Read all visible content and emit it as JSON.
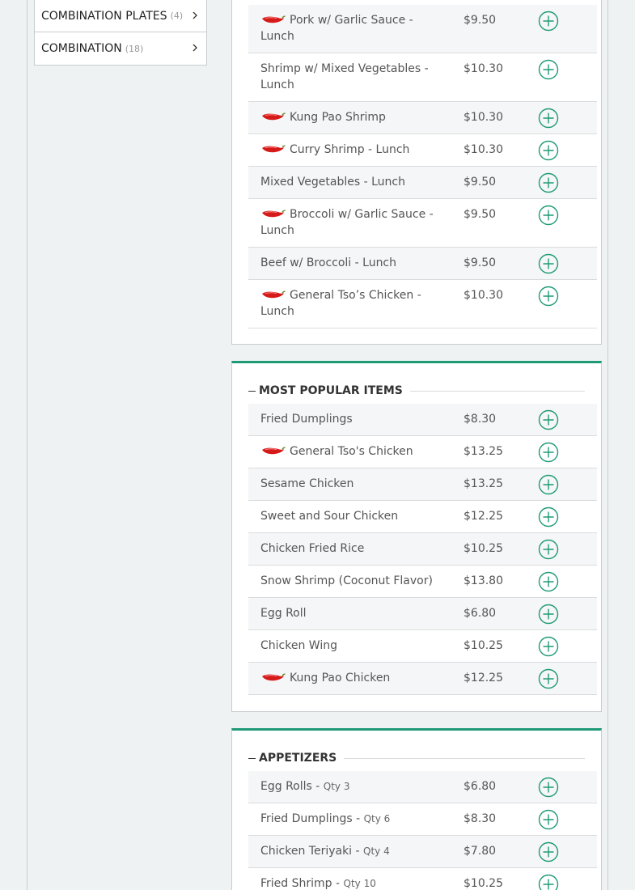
{
  "colors": {
    "accent": "#1f9a76",
    "pepper": "#d51a1a"
  },
  "sidebar": {
    "categories": [
      {
        "name": "COMBINATION PLATES",
        "count": "(4)"
      },
      {
        "name": "COMBINATION",
        "count": "(18)"
      }
    ]
  },
  "lunch_section": {
    "items": [
      {
        "name": "Pork w/ Garlic Sauce - Lunch",
        "price": "$9.50",
        "spicy": true
      },
      {
        "name": "Shrimp w/ Mixed Vegetables - Lunch",
        "price": "$10.30",
        "spicy": false
      },
      {
        "name": "Kung Pao Shrimp",
        "price": "$10.30",
        "spicy": true
      },
      {
        "name": "Curry Shrimp - Lunch",
        "price": "$10.30",
        "spicy": true
      },
      {
        "name": "Mixed Vegetables - Lunch",
        "price": "$9.50",
        "spicy": false
      },
      {
        "name": "Broccoli w/ Garlic Sauce - Lunch",
        "price": "$9.50",
        "spicy": true
      },
      {
        "name": "Beef w/ Broccoli - Lunch",
        "price": "$9.50",
        "spicy": false
      },
      {
        "name": "General Tso’s Chicken - Lunch",
        "price": "$10.30",
        "spicy": true
      }
    ]
  },
  "popular_section": {
    "title": "MOST POPULAR ITEMS",
    "items": [
      {
        "name": "Fried Dumplings",
        "price": "$8.30",
        "spicy": false
      },
      {
        "name": "General Tso's Chicken",
        "price": "$13.25",
        "spicy": true
      },
      {
        "name": "Sesame Chicken",
        "price": "$13.25",
        "spicy": false
      },
      {
        "name": "Sweet and Sour Chicken",
        "price": "$12.25",
        "spicy": false
      },
      {
        "name": "Chicken Fried Rice",
        "price": "$10.25",
        "spicy": false
      },
      {
        "name": "Snow Shrimp (Coconut Flavor)",
        "price": "$13.80",
        "spicy": false
      },
      {
        "name": "Egg Roll",
        "price": "$6.80",
        "spicy": false
      },
      {
        "name": "Chicken Wing",
        "price": "$10.25",
        "spicy": false
      },
      {
        "name": "Kung Pao Chicken",
        "price": "$12.25",
        "spicy": true
      }
    ]
  },
  "appetizers_section": {
    "title": "APPETIZERS",
    "items": [
      {
        "name": "Egg Rolls - ",
        "qty": "Qty 3",
        "price": "$6.80"
      },
      {
        "name": "Fried Dumplings - ",
        "qty": "Qty 6",
        "price": "$8.30"
      },
      {
        "name": "Chicken Teriyaki - ",
        "qty": "Qty 4",
        "price": "$7.80"
      },
      {
        "name": "Fried Shrimp - ",
        "qty": "Qty 10",
        "price": "$10.25"
      }
    ]
  }
}
